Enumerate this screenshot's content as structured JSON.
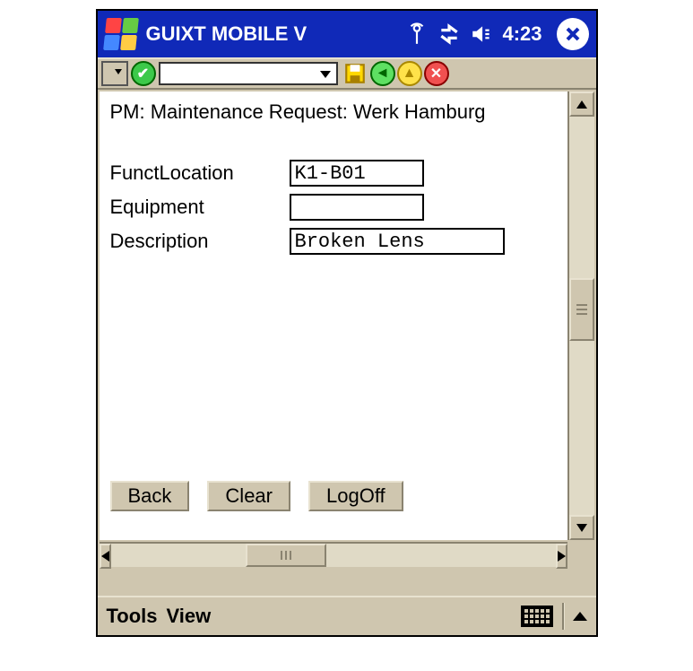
{
  "titlebar": {
    "app_title": "GUIXT MOBILE V",
    "clock": "4:23"
  },
  "toolbar": {
    "dropdown_value": ""
  },
  "page": {
    "heading": "PM: Maintenance Request: Werk Hamburg",
    "fields": {
      "funct_location": {
        "label": "FunctLocation",
        "value": "K1-B01"
      },
      "equipment": {
        "label": "Equipment",
        "value": ""
      },
      "description": {
        "label": "Description",
        "value": "Broken Lens"
      }
    },
    "buttons": {
      "back": "Back",
      "clear": "Clear",
      "logoff": "LogOff"
    }
  },
  "bottombar": {
    "tools": "Tools",
    "view": "View"
  }
}
